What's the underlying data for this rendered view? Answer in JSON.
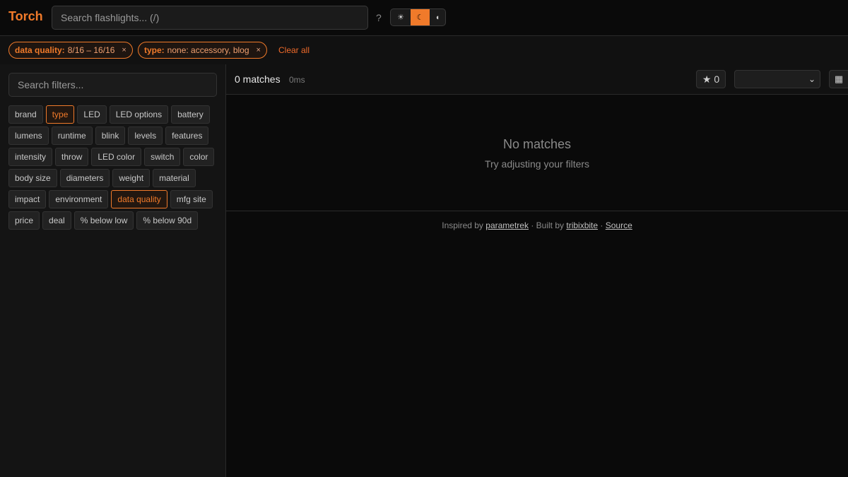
{
  "header": {
    "logo": "Torch",
    "search_placeholder": "Search flashlights... (/)",
    "help": "?",
    "theme": [
      {
        "icon": "sun-icon",
        "glyph": "☀"
      },
      {
        "icon": "moon-icon",
        "glyph": "☾"
      },
      {
        "icon": "auto-icon",
        "glyph": "◖"
      }
    ]
  },
  "filters": {
    "chips": [
      {
        "key": "data quality:",
        "value": "8/16 – 16/16",
        "remove": "×"
      },
      {
        "key": "type:",
        "value": "none: accessory, blog",
        "remove": "×"
      }
    ],
    "clear_all": "Clear all"
  },
  "sidebar": {
    "search_placeholder": "Search filters...",
    "tags": [
      {
        "label": "brand"
      },
      {
        "label": "type"
      },
      {
        "label": "LED"
      },
      {
        "label": "LED options"
      },
      {
        "label": "battery"
      },
      {
        "label": "lumens"
      },
      {
        "label": "runtime"
      },
      {
        "label": "blink"
      },
      {
        "label": "levels"
      },
      {
        "label": "features"
      },
      {
        "label": "intensity"
      },
      {
        "label": "throw"
      },
      {
        "label": "LED color"
      },
      {
        "label": "switch"
      },
      {
        "label": "color"
      },
      {
        "label": "body size"
      },
      {
        "label": "diameters"
      },
      {
        "label": "weight"
      },
      {
        "label": "material"
      },
      {
        "label": "impact"
      },
      {
        "label": "environment"
      },
      {
        "label": "data quality"
      },
      {
        "label": "mfg site"
      },
      {
        "label": "price"
      },
      {
        "label": "deal"
      },
      {
        "label": "% below low"
      },
      {
        "label": "% below 90d"
      }
    ]
  },
  "main": {
    "matches": "0 matches",
    "time": "0ms",
    "star": "★ 0",
    "sort_arrow": "⌄",
    "grid_icon": "▦",
    "empty_title": "No matches",
    "empty_sub": "Try adjusting your filters"
  },
  "footer": {
    "inspired": "Inspired by",
    "parametrek": "parametrek",
    "built": "· Built by",
    "tribixbite": "tribixbite",
    "dot": "·",
    "source": "Source"
  },
  "colors": {
    "accent": "#f07a2a",
    "background": "#0a0a0a"
  }
}
